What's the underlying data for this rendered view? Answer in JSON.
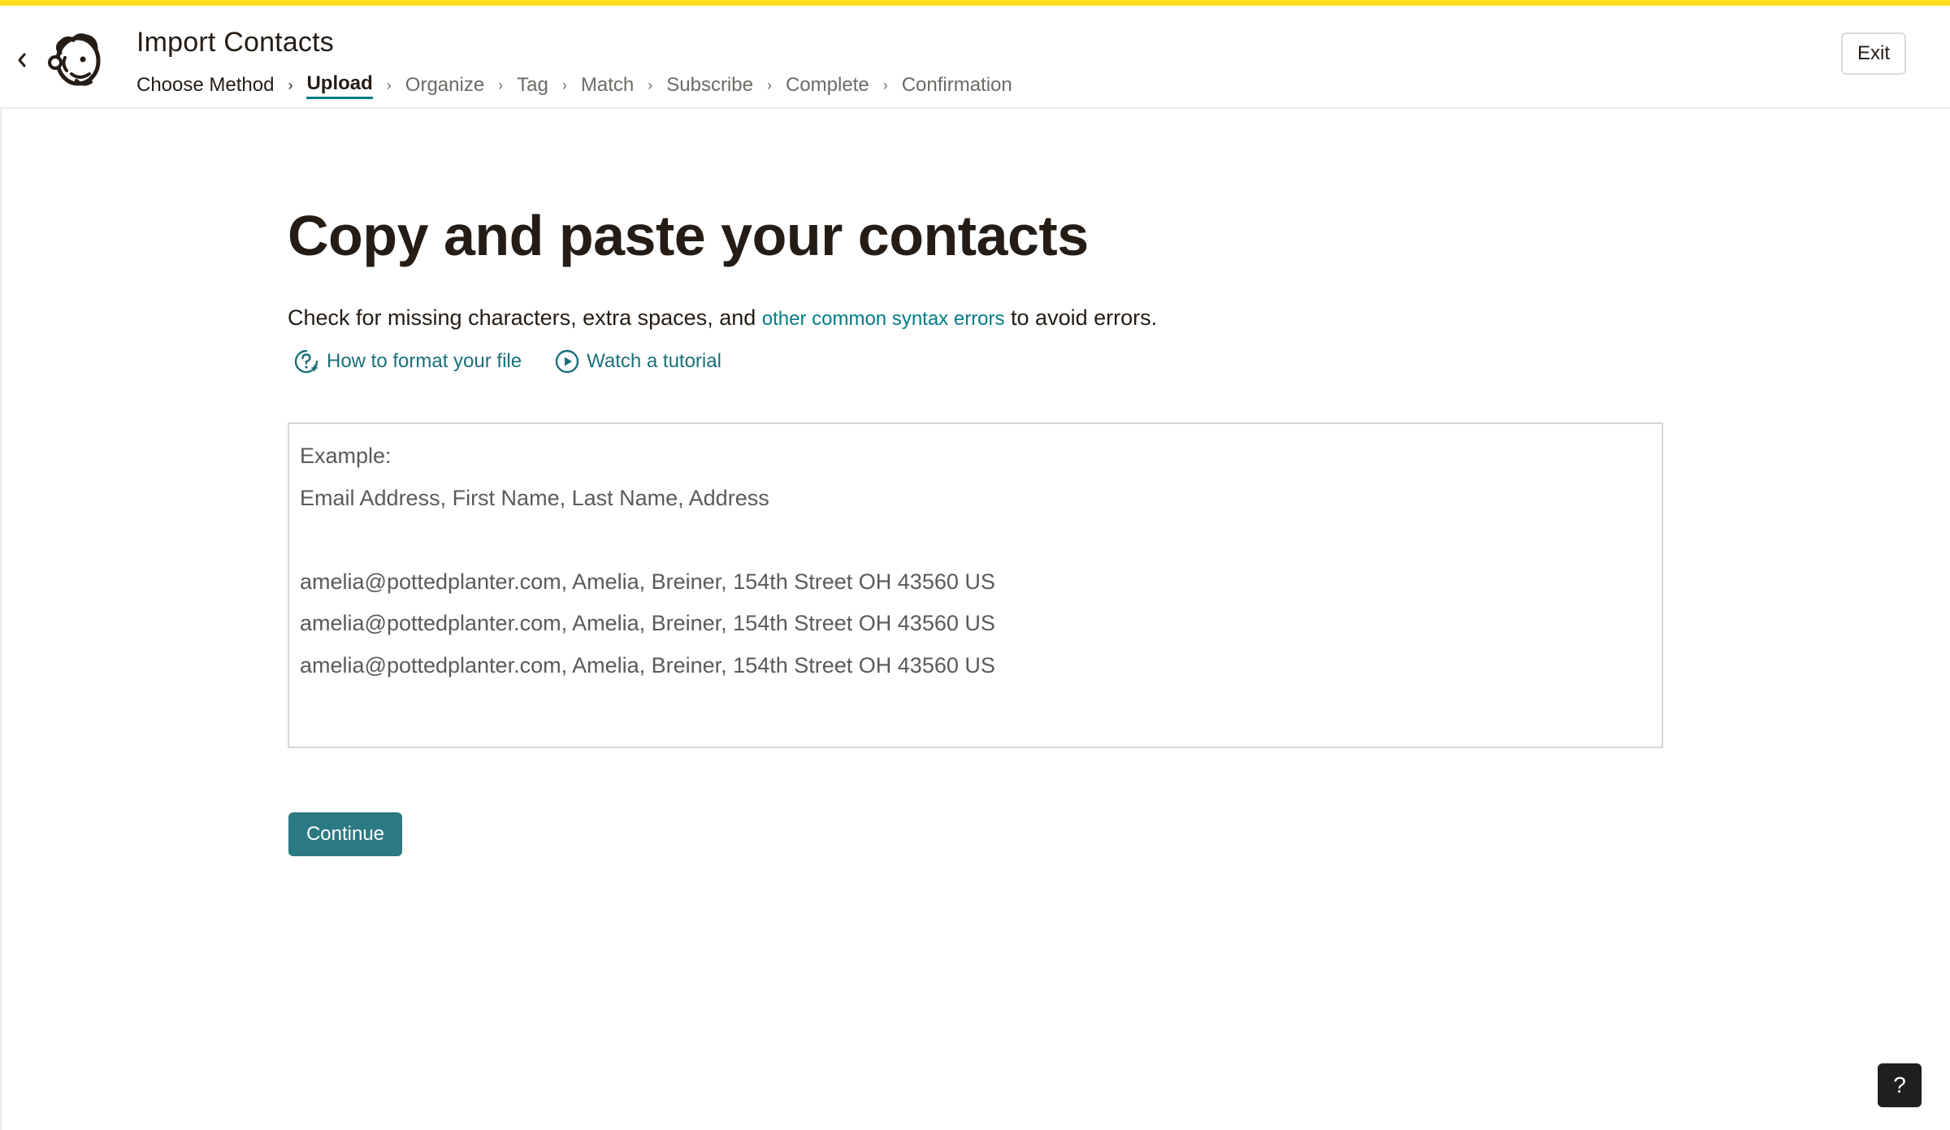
{
  "header": {
    "title": "Import Contacts",
    "exit_label": "Exit",
    "steps": [
      {
        "label": "Choose Method",
        "state": "done"
      },
      {
        "label": "Upload",
        "state": "current"
      },
      {
        "label": "Organize",
        "state": "upcoming"
      },
      {
        "label": "Tag",
        "state": "upcoming"
      },
      {
        "label": "Match",
        "state": "upcoming"
      },
      {
        "label": "Subscribe",
        "state": "upcoming"
      },
      {
        "label": "Complete",
        "state": "upcoming"
      },
      {
        "label": "Confirmation",
        "state": "upcoming"
      }
    ]
  },
  "main": {
    "heading": "Copy and paste your contacts",
    "description_before": "Check for missing characters, extra spaces, and ",
    "description_link": "other common syntax errors",
    "description_after": " to avoid errors.",
    "help_links": {
      "format": "How to format your file",
      "tutorial": "Watch a tutorial"
    },
    "paste_placeholder_lines": [
      "Example:",
      "Email Address, First Name, Last Name, Address",
      "",
      "amelia@pottedplanter.com, Amelia, Breiner, 154th Street OH 43560 US",
      "amelia@pottedplanter.com, Amelia, Breiner, 154th Street OH 43560 US",
      "amelia@pottedplanter.com, Amelia, Breiner, 154th Street OH 43560 US"
    ],
    "continue_label": "Continue"
  },
  "help_button_label": "?",
  "colors": {
    "accent_stripe": "#ffe01b",
    "link": "#007c89",
    "primary_button": "#2b7a83",
    "help_button": "#1f1f1f"
  }
}
